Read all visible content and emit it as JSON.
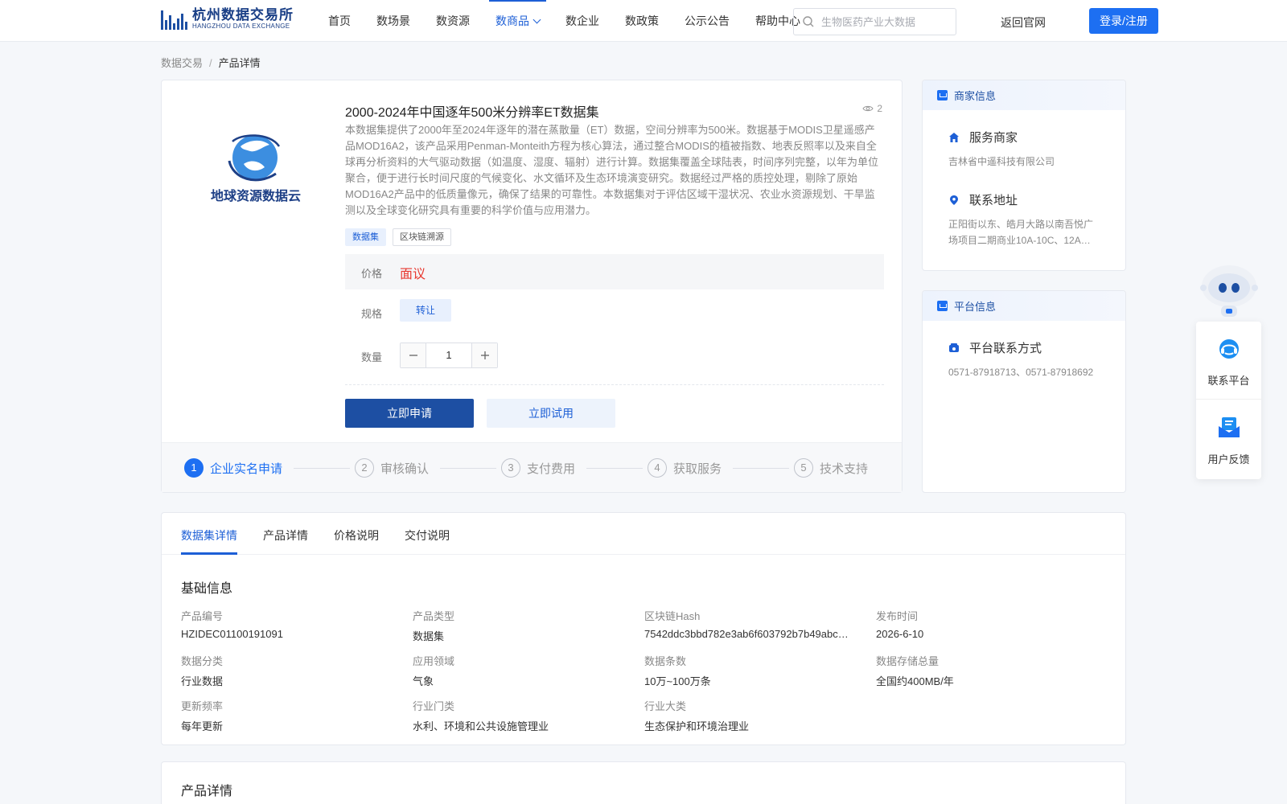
{
  "header": {
    "logo_cn": "杭州数据交易所",
    "logo_en": "HANGZHOU DATA EXCHANGE",
    "nav": [
      {
        "label": "首页"
      },
      {
        "label": "数场景"
      },
      {
        "label": "数资源"
      },
      {
        "label": "数商品",
        "active": true
      },
      {
        "label": "数企业"
      },
      {
        "label": "数政策"
      },
      {
        "label": "公示公告"
      },
      {
        "label": "帮助中心"
      }
    ],
    "search_placeholder": "生物医药产业大数据",
    "back_link": "返回官网",
    "login_label": "登录/注册",
    "accent_color": "#1d6ff2"
  },
  "breadcrumb": {
    "root": "数据交易",
    "separator": "/",
    "current": "产品详情"
  },
  "product": {
    "logo_text": "地球资源数据云",
    "title": "2000-2024年中国逐年500米分辨率ET数据集",
    "views": "2",
    "description": "本数据集提供了2000年至2024年逐年的潜在蒸散量（ET）数据，空间分辨率为500米。数据基于MODIS卫星遥感产品MOD16A2，该产品采用Penman-Monteith方程为核心算法，通过整合MODIS的植被指数、地表反照率以及来自全球再分析资料的大气驱动数据（如温度、湿度、辐射）进行计算。数据集覆盖全球陆表，时间序列完整，以年为单位聚合，便于进行长时间尺度的气候变化、水文循环及生态环境演变研究。数据经过严格的质控处理，剔除了原始MOD16A2产品中的低质量像元，确保了结果的可靠性。本数据集对于评估区域干湿状况、农业水资源规划、干旱监测以及全球变化研究具有重要的科学价值与应用潜力。",
    "tags": [
      "数据集",
      "区块链溯源"
    ],
    "price_label": "价格",
    "price_value": "面议",
    "spec_label": "规格",
    "spec_value": "转让",
    "qty_label": "数量",
    "qty_value": "1",
    "apply_label": "立即申请",
    "trial_label": "立即试用",
    "price_color": "#e8382f"
  },
  "steps": [
    {
      "num": "1",
      "label": "企业实名申请",
      "active": true
    },
    {
      "num": "2",
      "label": "审核确认"
    },
    {
      "num": "3",
      "label": "支付费用"
    },
    {
      "num": "4",
      "label": "获取服务"
    },
    {
      "num": "5",
      "label": "技术支持"
    }
  ],
  "merchant": {
    "header": "商家信息",
    "service_title": "服务商家",
    "service_value": "吉林省中遥科技有限公司",
    "address_title": "联系地址",
    "address_value": "正阳街以东、皓月大路以南吾悦广场项目二期商业10A-10C、12A…"
  },
  "platform": {
    "header": "平台信息",
    "contact_title": "平台联系方式",
    "contact_value": "0571-87918713、0571-87918692"
  },
  "float": {
    "contact_label": "联系平台",
    "feedback_label": "用户反馈"
  },
  "details": {
    "tabs": [
      {
        "label": "数据集详情",
        "active": true
      },
      {
        "label": "产品详情"
      },
      {
        "label": "价格说明"
      },
      {
        "label": "交付说明"
      }
    ],
    "section_title": "基础信息",
    "fields": [
      {
        "label": "产品编号",
        "value": "HZIDEC01100191091"
      },
      {
        "label": "产品类型",
        "value": "数据集"
      },
      {
        "label": "区块链Hash",
        "value": "7542ddc3bbd782e3ab6f603792b7b49abc…"
      },
      {
        "label": "发布时间",
        "value": "2026-6-10"
      },
      {
        "label": "数据分类",
        "value": "行业数据"
      },
      {
        "label": "应用领域",
        "value": "气象"
      },
      {
        "label": "数据条数",
        "value": "10万~100万条"
      },
      {
        "label": "数据存储总量",
        "value": "全国约400MB/年"
      },
      {
        "label": "更新频率",
        "value": "每年更新"
      },
      {
        "label": "行业门类",
        "value": "水利、环境和公共设施管理业"
      },
      {
        "label": "行业大类",
        "value": "生态保护和环境治理业"
      }
    ],
    "section2_title": "产品详情"
  }
}
